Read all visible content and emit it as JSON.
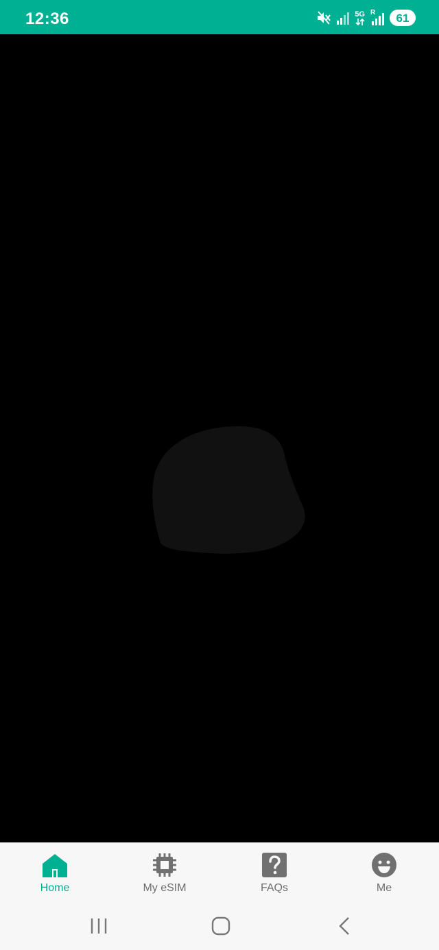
{
  "status_bar": {
    "time": "12:36",
    "battery_level": "61",
    "network_label": "5G",
    "roaming_label": "R",
    "icons": [
      "mute-icon",
      "signal-icon",
      "5g-icon",
      "roaming-signal-icon",
      "battery-icon"
    ]
  },
  "colors": {
    "accent": "#00B092",
    "content_background": "#000000",
    "nav_background": "#F7F7F7",
    "inactive_label": "#6E6E6E"
  },
  "bottom_nav": {
    "items": [
      {
        "label": "Home",
        "icon": "home-icon",
        "active": true
      },
      {
        "label": "My eSIM",
        "icon": "chip-icon",
        "active": false
      },
      {
        "label": "FAQs",
        "icon": "question-icon",
        "active": false
      },
      {
        "label": "Me",
        "icon": "face-icon",
        "active": false
      }
    ]
  },
  "system_nav": {
    "buttons": [
      "recents-icon",
      "home-button-icon",
      "back-icon"
    ]
  }
}
